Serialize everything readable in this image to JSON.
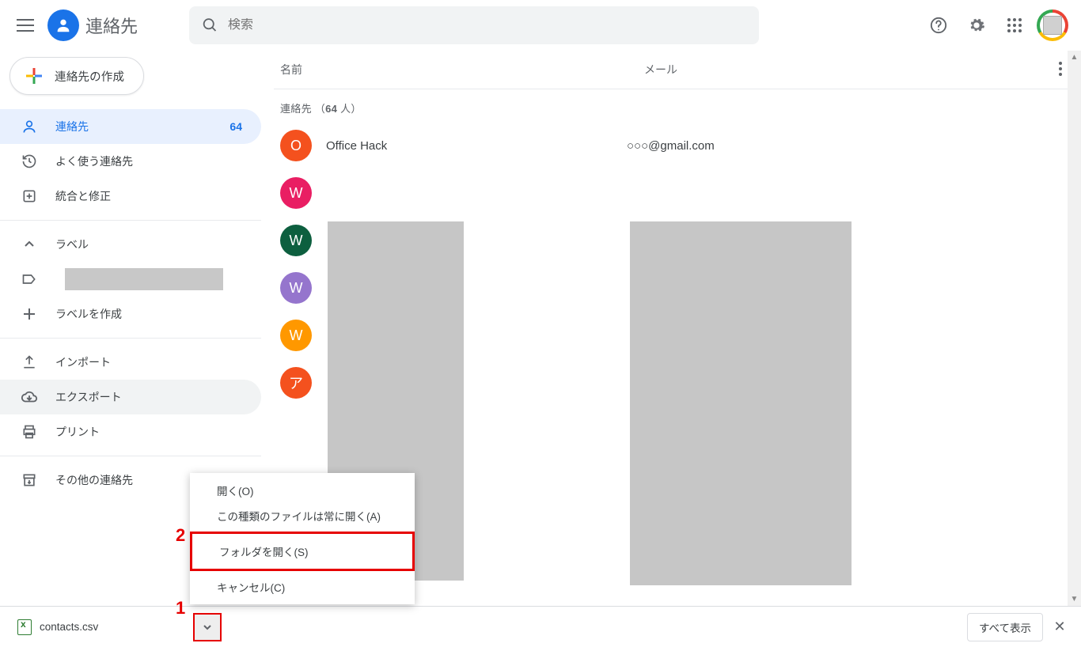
{
  "header": {
    "title": "連絡先",
    "search_placeholder": "検索"
  },
  "sidebar": {
    "create_label": "連絡先の作成",
    "items": {
      "contacts": {
        "label": "連絡先",
        "count": "64"
      },
      "frequent": {
        "label": "よく使う連絡先"
      },
      "merge": {
        "label": "統合と修正"
      },
      "labels_header": {
        "label": "ラベル"
      },
      "create_label": {
        "label": "ラベルを作成"
      },
      "import": {
        "label": "インポート"
      },
      "export": {
        "label": "エクスポート"
      },
      "print": {
        "label": "プリント"
      },
      "other": {
        "label": "その他の連絡先"
      }
    }
  },
  "main": {
    "columns": {
      "name": "名前",
      "email": "メール"
    },
    "count_prefix": "連絡先 （",
    "count_value": "64",
    "count_suffix": " 人）",
    "rows": [
      {
        "initial": "O",
        "color": "#f4511e",
        "name": "Office Hack",
        "email": "○○○@gmail.com"
      },
      {
        "initial": "W",
        "color": "#e91e63"
      },
      {
        "initial": "W",
        "color": "#0d5f3f"
      },
      {
        "initial": "W",
        "color": "#9575cd"
      },
      {
        "initial": "W",
        "color": "#ff9800"
      },
      {
        "initial": "ア",
        "color": "#f4511e"
      }
    ]
  },
  "context_menu": {
    "open": "開く(O)",
    "always": "この種類のファイルは常に開く(A)",
    "open_folder": "フォルダを開く(S)",
    "cancel": "キャンセル(C)"
  },
  "download": {
    "filename": "contacts.csv",
    "show_all": "すべて表示"
  },
  "markers": {
    "one": "1",
    "two": "2"
  }
}
